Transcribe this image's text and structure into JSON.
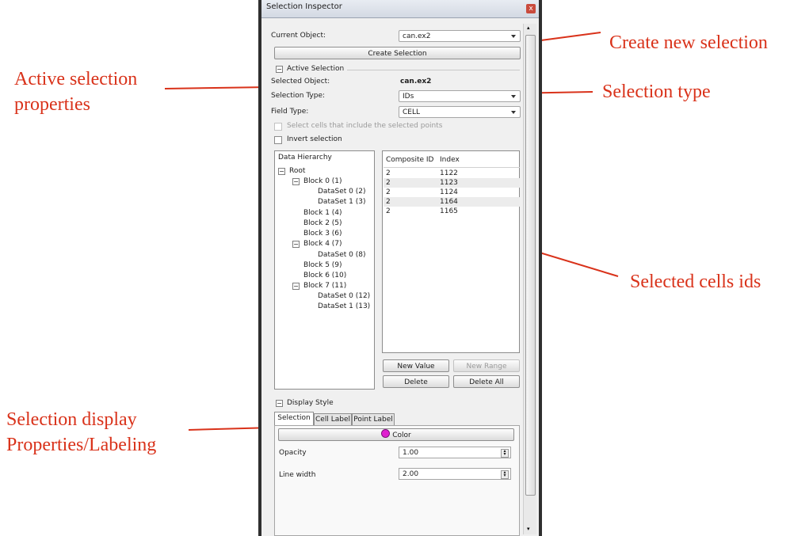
{
  "window": {
    "title": "Selection Inspector",
    "close_glyph": "x"
  },
  "current_object": {
    "label": "Current Object:",
    "value": "can.ex2"
  },
  "create_button": "Create Selection",
  "active_selection": {
    "group_label": "Active Selection",
    "selected_object_label": "Selected Object:",
    "selected_object_value": "can.ex2",
    "selection_type_label": "Selection Type:",
    "selection_type_value": "IDs",
    "field_type_label": "Field Type:",
    "field_type_value": "CELL",
    "include_points_label": "Select cells that include the selected points",
    "invert_label": "Invert selection"
  },
  "hierarchy": {
    "header": "Data Hierarchy",
    "items": [
      "Root",
      "Block 0 (1)",
      "DataSet 0 (2)",
      "DataSet 1 (3)",
      "Block 1 (4)",
      "Block 2 (5)",
      "Block 3 (6)",
      "Block 4 (7)",
      "DataSet 0 (8)",
      "Block 5 (9)",
      "Block 6 (10)",
      "Block 7 (11)",
      "DataSet 0 (12)",
      "DataSet 1 (13)"
    ]
  },
  "ids_table": {
    "columns": [
      "Composite ID",
      "Index"
    ],
    "rows": [
      [
        "2",
        "1122"
      ],
      [
        "2",
        "1123"
      ],
      [
        "2",
        "1124"
      ],
      [
        "2",
        "1164"
      ],
      [
        "2",
        "1165"
      ]
    ]
  },
  "id_buttons": {
    "new_value": "New Value",
    "new_range": "New Range",
    "delete": "Delete",
    "delete_all": "Delete All"
  },
  "display_style": {
    "group_label": "Display Style",
    "tabs": [
      "Selection",
      "Cell Label",
      "Point Label"
    ],
    "color_button": "Color",
    "color_swatch": "#e01fd0",
    "opacity_label": "Opacity",
    "opacity_value": "1.00",
    "line_width_label": "Line width",
    "line_width_value": "2.00"
  },
  "annotations": {
    "create_new": "Create new selection",
    "active_props_line1": "Active selection",
    "active_props_line2": "properties",
    "selection_type": "Selection type",
    "selected_ids": "Selected cells ids",
    "display_line1": "Selection display",
    "display_line2": "Properties/Labeling"
  },
  "colors": {
    "annotation": "#d9321a"
  }
}
